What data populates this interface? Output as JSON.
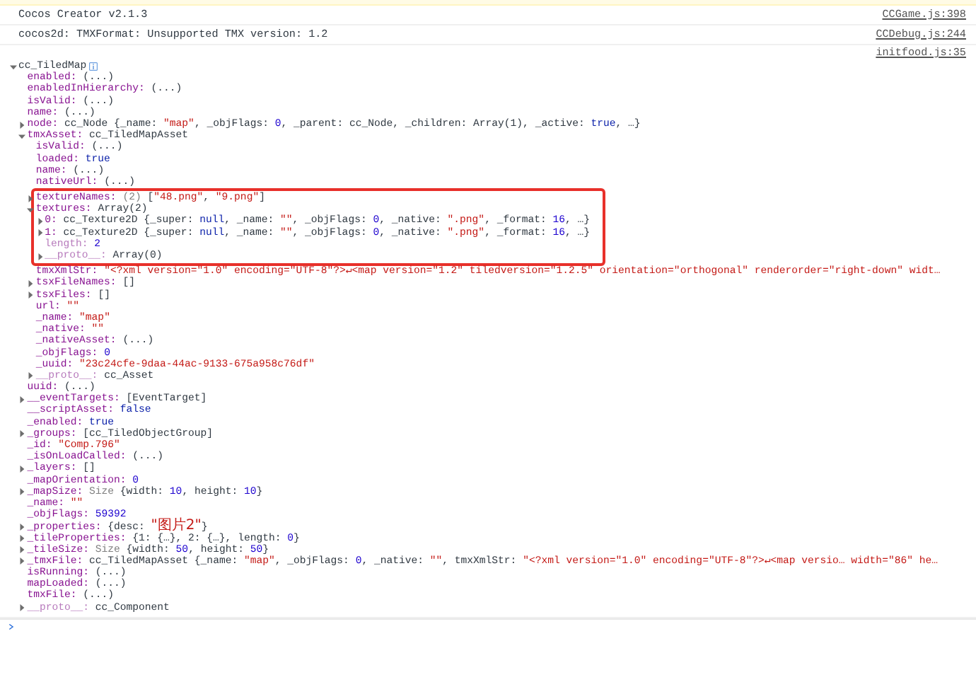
{
  "messages": [
    {
      "text": "Cocos Creator v2.1.3",
      "source": "CCGame.js:398"
    },
    {
      "text": "cocos2d: TMXFormat: Unsupported TMX version: 1.2",
      "source": "CCDebug.js:244"
    }
  ],
  "logged_object": {
    "source": "initfood.js:35",
    "label": "cc_TiledMap",
    "expanded": true,
    "children": [
      {
        "key": "enabled:",
        "dim": false,
        "value": [
          {
            "kind": "plain",
            "text": " (...)"
          }
        ]
      },
      {
        "key": "enabledInHierarchy:",
        "dim": false,
        "value": [
          {
            "kind": "plain",
            "text": " (...)"
          }
        ]
      },
      {
        "key": "isValid:",
        "dim": false,
        "value": [
          {
            "kind": "plain",
            "text": " (...)"
          }
        ]
      },
      {
        "key": "name:",
        "dim": false,
        "value": [
          {
            "kind": "plain",
            "text": " (...)"
          }
        ]
      },
      {
        "key": "node:",
        "dim": false,
        "expanded": false,
        "value": [
          {
            "kind": "plain",
            "text": " cc_Node {_name: "
          },
          {
            "kind": "string",
            "text": "\"map\""
          },
          {
            "kind": "plain",
            "text": ", _objFlags: "
          },
          {
            "kind": "number",
            "text": "0"
          },
          {
            "kind": "plain",
            "text": ", _parent: cc_Node, _children: Array(1), _active: "
          },
          {
            "kind": "keyword",
            "text": "true"
          },
          {
            "kind": "plain",
            "text": ", …}"
          }
        ]
      },
      {
        "key": "tmxAsset:",
        "dim": false,
        "expanded": true,
        "value": [
          {
            "kind": "plain",
            "text": " cc_TiledMapAsset"
          }
        ],
        "children": [
          {
            "key": "isValid:",
            "dim": false,
            "value": [
              {
                "kind": "plain",
                "text": " (...)"
              }
            ]
          },
          {
            "key": "loaded:",
            "dim": false,
            "value": [
              {
                "kind": "keyword",
                "text": " true"
              }
            ]
          },
          {
            "key": "name:",
            "dim": false,
            "value": [
              {
                "kind": "plain",
                "text": " (...)"
              }
            ]
          },
          {
            "key": "nativeUrl:",
            "dim": false,
            "value": [
              {
                "kind": "plain",
                "text": " (...)"
              }
            ]
          },
          {
            "key": "textureNames:",
            "dim": false,
            "highlighted": true,
            "expanded": false,
            "value": [
              {
                "kind": "muted",
                "text": " (2) "
              },
              {
                "kind": "plain",
                "text": "["
              },
              {
                "kind": "string",
                "text": "\"48.png\""
              },
              {
                "kind": "plain",
                "text": ", "
              },
              {
                "kind": "string",
                "text": "\"9.png\""
              },
              {
                "kind": "plain",
                "text": "]"
              }
            ]
          },
          {
            "key": "textures:",
            "dim": false,
            "highlighted": true,
            "expanded": true,
            "value": [
              {
                "kind": "plain",
                "text": " Array(2)"
              }
            ],
            "children": [
              {
                "key": "0:",
                "dim": false,
                "expanded": false,
                "value": [
                  {
                    "kind": "plain",
                    "text": " cc_Texture2D {_super: "
                  },
                  {
                    "kind": "keyword",
                    "text": "null"
                  },
                  {
                    "kind": "plain",
                    "text": ", _name: "
                  },
                  {
                    "kind": "string",
                    "text": "\"\""
                  },
                  {
                    "kind": "plain",
                    "text": ", _objFlags: "
                  },
                  {
                    "kind": "number",
                    "text": "0"
                  },
                  {
                    "kind": "plain",
                    "text": ", _native: "
                  },
                  {
                    "kind": "string",
                    "text": "\".png\""
                  },
                  {
                    "kind": "plain",
                    "text": ", _format: "
                  },
                  {
                    "kind": "number",
                    "text": "16"
                  },
                  {
                    "kind": "plain",
                    "text": ", …}"
                  }
                ]
              },
              {
                "key": "1:",
                "dim": false,
                "expanded": false,
                "value": [
                  {
                    "kind": "plain",
                    "text": " cc_Texture2D {_super: "
                  },
                  {
                    "kind": "keyword",
                    "text": "null"
                  },
                  {
                    "kind": "plain",
                    "text": ", _name: "
                  },
                  {
                    "kind": "string",
                    "text": "\"\""
                  },
                  {
                    "kind": "plain",
                    "text": ", _objFlags: "
                  },
                  {
                    "kind": "number",
                    "text": "0"
                  },
                  {
                    "kind": "plain",
                    "text": ", _native: "
                  },
                  {
                    "kind": "string",
                    "text": "\".png\""
                  },
                  {
                    "kind": "plain",
                    "text": ", _format: "
                  },
                  {
                    "kind": "number",
                    "text": "16"
                  },
                  {
                    "kind": "plain",
                    "text": ", …}"
                  }
                ]
              },
              {
                "key": "length:",
                "dim": true,
                "value": [
                  {
                    "kind": "number",
                    "text": " 2"
                  }
                ]
              },
              {
                "key": "__proto__:",
                "dim": true,
                "expanded": false,
                "value": [
                  {
                    "kind": "plain",
                    "text": " Array(0)"
                  }
                ]
              }
            ]
          },
          {
            "key": "tmxXmlStr:",
            "dim": false,
            "value": [
              {
                "kind": "string",
                "text": " \"<?xml version=\"1.0\" encoding=\"UTF-8\"?>↵<map version=\"1.2\" tiledversion=\"1.2.5\" orientation=\"orthogonal\" renderorder=\"right-down\" widt…"
              }
            ]
          },
          {
            "key": "tsxFileNames:",
            "dim": false,
            "expanded": false,
            "value": [
              {
                "kind": "plain",
                "text": " []"
              }
            ]
          },
          {
            "key": "tsxFiles:",
            "dim": false,
            "expanded": false,
            "value": [
              {
                "kind": "plain",
                "text": " []"
              }
            ]
          },
          {
            "key": "url:",
            "dim": false,
            "value": [
              {
                "kind": "string",
                "text": " \"\""
              }
            ]
          },
          {
            "key": "_name:",
            "dim": false,
            "value": [
              {
                "kind": "string",
                "text": " \"map\""
              }
            ]
          },
          {
            "key": "_native:",
            "dim": false,
            "value": [
              {
                "kind": "string",
                "text": " \"\""
              }
            ]
          },
          {
            "key": "_nativeAsset:",
            "dim": false,
            "value": [
              {
                "kind": "plain",
                "text": " (...)"
              }
            ]
          },
          {
            "key": "_objFlags:",
            "dim": false,
            "value": [
              {
                "kind": "number",
                "text": " 0"
              }
            ]
          },
          {
            "key": "_uuid:",
            "dim": false,
            "value": [
              {
                "kind": "string",
                "text": " \"23c24cfe-9daa-44ac-9133-675a958c76df\""
              }
            ]
          },
          {
            "key": "__proto__:",
            "dim": true,
            "expanded": false,
            "value": [
              {
                "kind": "plain",
                "text": " cc_Asset"
              }
            ]
          }
        ]
      },
      {
        "key": "uuid:",
        "dim": false,
        "value": [
          {
            "kind": "plain",
            "text": " (...)"
          }
        ]
      },
      {
        "key": "__eventTargets:",
        "dim": false,
        "expanded": false,
        "value": [
          {
            "kind": "plain",
            "text": " [EventTarget]"
          }
        ]
      },
      {
        "key": "__scriptAsset:",
        "dim": false,
        "value": [
          {
            "kind": "keyword",
            "text": " false"
          }
        ]
      },
      {
        "key": "_enabled:",
        "dim": false,
        "value": [
          {
            "kind": "keyword",
            "text": " true"
          }
        ]
      },
      {
        "key": "_groups:",
        "dim": false,
        "expanded": false,
        "value": [
          {
            "kind": "plain",
            "text": " [cc_TiledObjectGroup]"
          }
        ]
      },
      {
        "key": "_id:",
        "dim": false,
        "value": [
          {
            "kind": "string",
            "text": " \"Comp.796\""
          }
        ]
      },
      {
        "key": "_isOnLoadCalled:",
        "dim": false,
        "value": [
          {
            "kind": "plain",
            "text": " (...)"
          }
        ]
      },
      {
        "key": "_layers:",
        "dim": false,
        "expanded": false,
        "value": [
          {
            "kind": "plain",
            "text": " []"
          }
        ]
      },
      {
        "key": "_mapOrientation:",
        "dim": false,
        "value": [
          {
            "kind": "number",
            "text": " 0"
          }
        ]
      },
      {
        "key": "_mapSize:",
        "dim": false,
        "expanded": false,
        "value": [
          {
            "kind": "muted",
            "text": " Size "
          },
          {
            "kind": "plain",
            "text": "{width: "
          },
          {
            "kind": "number",
            "text": "10"
          },
          {
            "kind": "plain",
            "text": ", height: "
          },
          {
            "kind": "number",
            "text": "10"
          },
          {
            "kind": "plain",
            "text": "}"
          }
        ]
      },
      {
        "key": "_name:",
        "dim": false,
        "value": [
          {
            "kind": "string",
            "text": " \"\""
          }
        ]
      },
      {
        "key": "_objFlags:",
        "dim": false,
        "value": [
          {
            "kind": "number",
            "text": " 59392"
          }
        ]
      },
      {
        "key": "_properties:",
        "dim": false,
        "expanded": false,
        "value": [
          {
            "kind": "plain",
            "text": " {desc: "
          },
          {
            "kind": "cjk_string",
            "text": "\"图片2\""
          },
          {
            "kind": "plain",
            "text": "}"
          }
        ]
      },
      {
        "key": "_tileProperties:",
        "dim": false,
        "expanded": false,
        "value": [
          {
            "kind": "plain",
            "text": " {1: {…}, 2: {…}, length: "
          },
          {
            "kind": "number",
            "text": "0"
          },
          {
            "kind": "plain",
            "text": "}"
          }
        ]
      },
      {
        "key": "_tileSize:",
        "dim": false,
        "expanded": false,
        "value": [
          {
            "kind": "muted",
            "text": " Size "
          },
          {
            "kind": "plain",
            "text": "{width: "
          },
          {
            "kind": "number",
            "text": "50"
          },
          {
            "kind": "plain",
            "text": ", height: "
          },
          {
            "kind": "number",
            "text": "50"
          },
          {
            "kind": "plain",
            "text": "}"
          }
        ]
      },
      {
        "key": "_tmxFile:",
        "dim": false,
        "expanded": false,
        "value": [
          {
            "kind": "plain",
            "text": " cc_TiledMapAsset {_name: "
          },
          {
            "kind": "string",
            "text": "\"map\""
          },
          {
            "kind": "plain",
            "text": ", _objFlags: "
          },
          {
            "kind": "number",
            "text": "0"
          },
          {
            "kind": "plain",
            "text": ", _native: "
          },
          {
            "kind": "string",
            "text": "\"\""
          },
          {
            "kind": "plain",
            "text": ", tmxXmlStr: "
          },
          {
            "kind": "string",
            "text": "\"<?xml version=\"1.0\" encoding=\"UTF-8\"?>↵<map versio… width=\"86\" he…"
          }
        ]
      },
      {
        "key": "isRunning:",
        "dim": false,
        "value": [
          {
            "kind": "plain",
            "text": " (...)"
          }
        ]
      },
      {
        "key": "mapLoaded:",
        "dim": false,
        "value": [
          {
            "kind": "plain",
            "text": " (...)"
          }
        ]
      },
      {
        "key": "tmxFile:",
        "dim": false,
        "value": [
          {
            "kind": "plain",
            "text": " (...)"
          }
        ]
      },
      {
        "key": "__proto__:",
        "dim": true,
        "expanded": false,
        "value": [
          {
            "kind": "plain",
            "text": " cc_Component"
          }
        ]
      }
    ]
  }
}
